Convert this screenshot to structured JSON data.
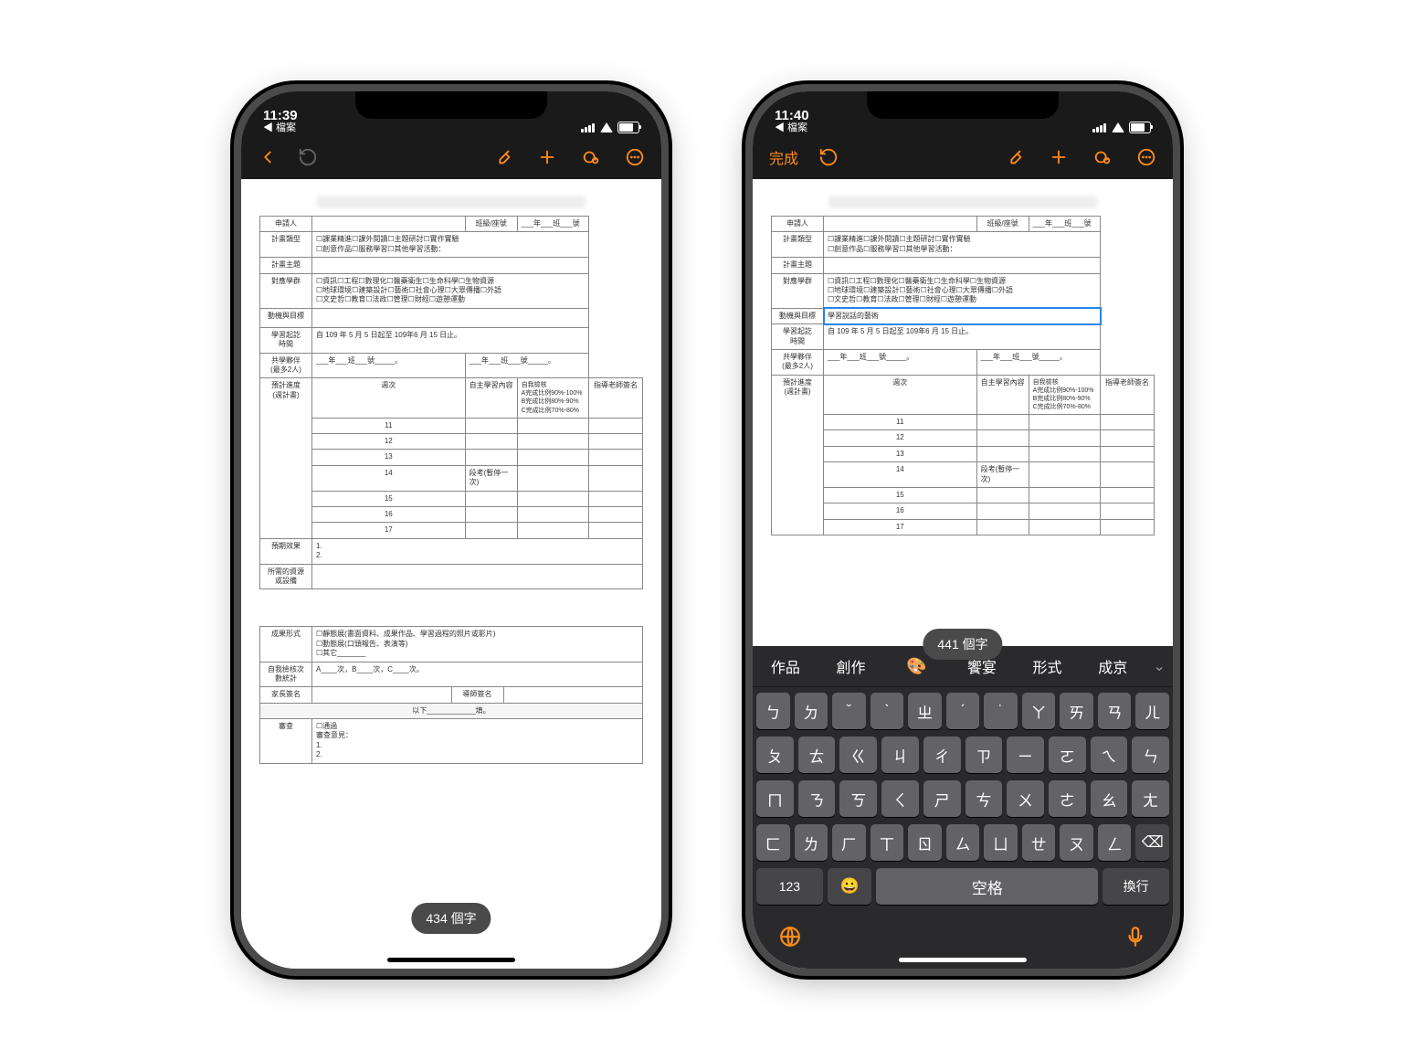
{
  "left": {
    "status": {
      "time": "11:39",
      "back": "◀ 檔案"
    },
    "word_count": "434 個字",
    "form": {
      "applicant_lbl": "申請人",
      "class_lbl": "班級/座號",
      "class_val": "___年___班___號",
      "plan_type_lbl": "計畫類型",
      "plan_type_val": "☐課業精進☐課外閱讀☐主題研討☐實作實驗\n☐創意作品☐服務學習☐其他學習活動：",
      "plan_topic_lbl": "計畫主題",
      "group_lbl": "對應學群",
      "group_val": "☐資訊☐工程☐數理化☐醫藥衛生☐生命科學☐生物資源\n☐地球環境☐建築設計☐藝術☐社會心理☐大眾傳播☐外語\n☐文史哲☐教育☐法政☐管理☐財經☐遊憩運動",
      "motive_lbl": "動機與目標",
      "period_lbl": "學習起訖\n時間",
      "period_val": "自 109 年 5 月 5 日起至 109年6 月 15 日止。",
      "partner_lbl": "共學夥伴\n(最多2人)",
      "partner_val": "___年___班___號_____。",
      "partner_val2": "___年___班___號_____。",
      "schedule_lbl": "預計進度\n(週計畫)",
      "sch_h1": "週次",
      "sch_h2": "自主學習內容",
      "sch_h3": "自我檢核\nA完成比例90%-100%\nB完成比例80%-90%\nC完成比例70%-80%",
      "sch_h4": "指導老師簽名",
      "weeks": [
        "11",
        "12",
        "13",
        "14",
        "15",
        "16",
        "17"
      ],
      "w14_note": "段考(暫停一次)",
      "expect_lbl": "預期效果",
      "expect_val": "1.\n2.",
      "resource_lbl": "所需的資源\n或設備",
      "result_lbl": "成果形式",
      "result_val": "☐靜態展(書面資料、成果作品、學習過程的照片或影片)\n☐動態展(口頭報告、表演等)\n☐其它_______",
      "self_lbl": "自我檢核次\n數統計",
      "self_val": "A____次，B____次，C____次。",
      "parent_lbl": "家長簽名",
      "mentor_lbl": "導師簽名",
      "below": "以下____________填。",
      "review_lbl": "審查",
      "review_val": "☐通過\n審查意見：\n1.\n2."
    }
  },
  "right": {
    "status": {
      "time": "11:40",
      "back": "◀ 檔案"
    },
    "toolbar_done": "完成",
    "word_count": "441 個字",
    "editing_text": "學習說話的藝術",
    "kb": {
      "sugg": [
        "作品",
        "創作",
        "🎨",
        "饗宴",
        "形式",
        "成京"
      ],
      "row1": [
        "ㄅ",
        "ㄉ",
        "ˇ",
        "ˋ",
        "ㄓ",
        "ˊ",
        "˙",
        "ㄚ",
        "ㄞ",
        "ㄢ",
        "ㄦ"
      ],
      "row2": [
        "ㄆ",
        "ㄊ",
        "ㄍ",
        "ㄐ",
        "ㄔ",
        "ㄗ",
        "ㄧ",
        "ㄛ",
        "ㄟ",
        "ㄣ"
      ],
      "row3": [
        "ㄇ",
        "ㄋ",
        "ㄎ",
        "ㄑ",
        "ㄕ",
        "ㄘ",
        "ㄨ",
        "ㄜ",
        "ㄠ",
        "ㄤ"
      ],
      "row4": [
        "ㄈ",
        "ㄌ",
        "ㄏ",
        "ㄒ",
        "ㄖ",
        "ㄙ",
        "ㄩ",
        "ㄝ",
        "ㄡ",
        "ㄥ",
        "⌫"
      ],
      "row5_123": "123",
      "row5_space": "空格",
      "row5_return": "換行"
    }
  }
}
